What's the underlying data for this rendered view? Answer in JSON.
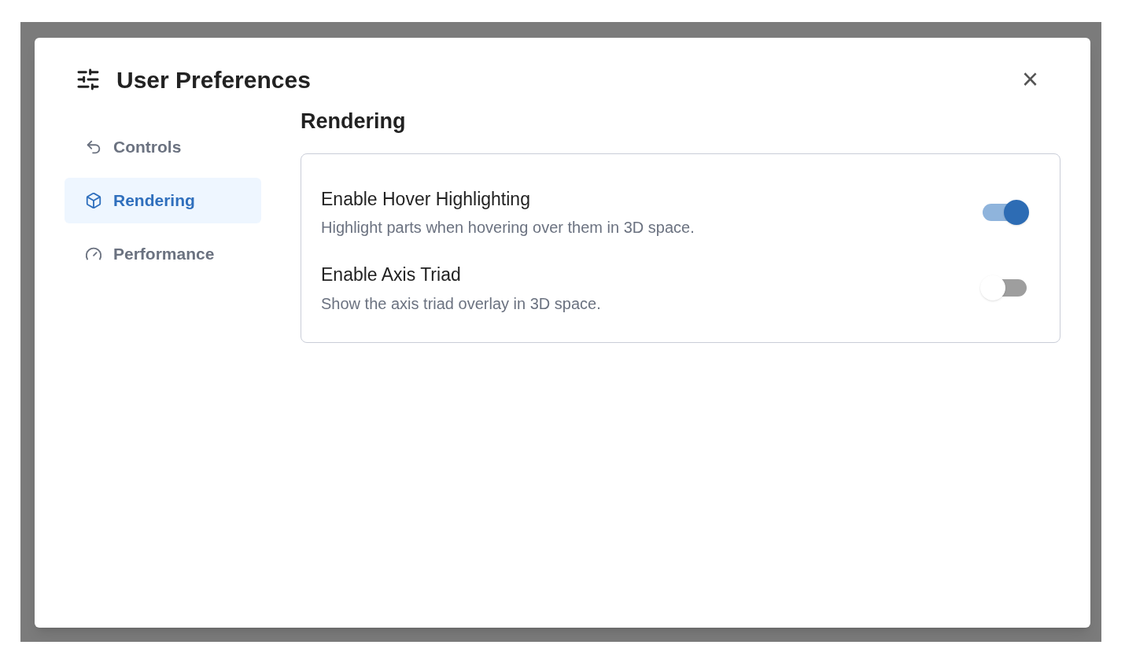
{
  "dialog": {
    "title": "User Preferences",
    "close": "×"
  },
  "sidebar": {
    "items": [
      {
        "label": "Controls",
        "selected": false
      },
      {
        "label": "Rendering",
        "selected": true
      },
      {
        "label": "Performance",
        "selected": false
      }
    ]
  },
  "section": {
    "title": "Rendering",
    "settings": [
      {
        "label": "Enable Hover Highlighting",
        "description": "Highlight parts when hovering over them in 3D space.",
        "on": true
      },
      {
        "label": "Enable Axis Triad",
        "description": "Show the axis triad overlay in 3D space.",
        "on": false
      }
    ]
  }
}
